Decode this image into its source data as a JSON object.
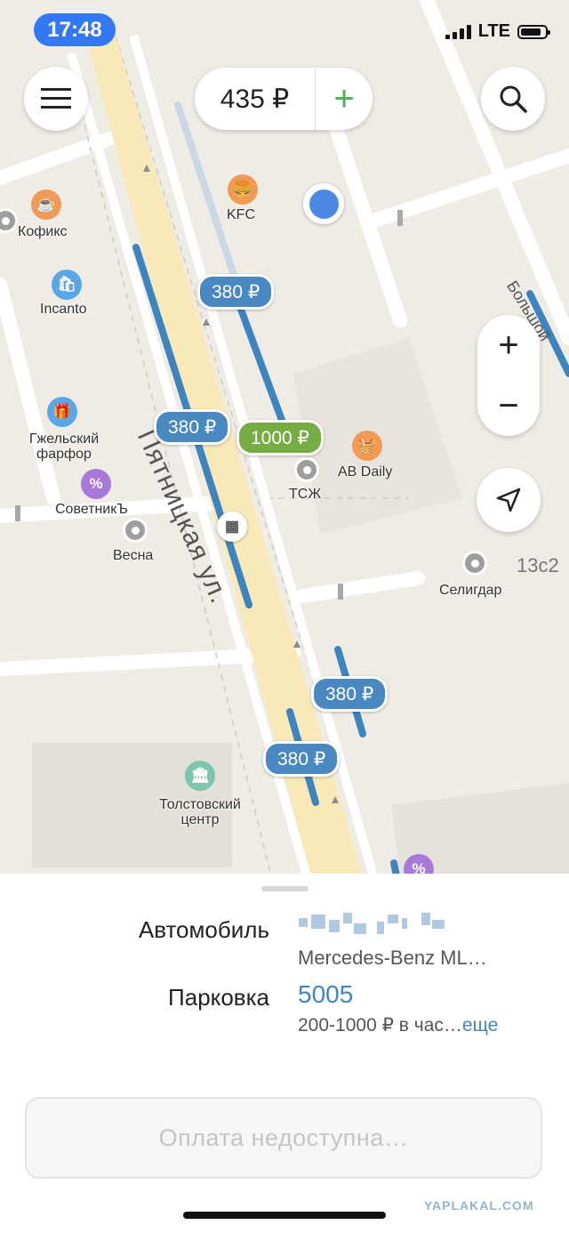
{
  "status_bar": {
    "time": "17:48",
    "network": "LTE"
  },
  "balance": {
    "amount": "435 ₽",
    "add_label": "+"
  },
  "zoom": {
    "in_label": "+",
    "out_label": "−"
  },
  "map": {
    "street_name": "Пятницкая ул.",
    "street_name_2": "Большой",
    "house_number": "13с2",
    "poi": {
      "kfc": "KFC",
      "kofiks": "Кофикс",
      "incanto": "Incanto",
      "gzhel": "Гжельский фарфор",
      "sovetnik": "СоветникЪ",
      "vesna": "Весна",
      "tszh": "ТСЖ",
      "av_daily": "AB Daily",
      "seligdar": "Селигдар",
      "tolstoy": "Толстовский центр"
    },
    "prices": [
      "380 ₽",
      "380 ₽",
      "1000 ₽",
      "380 ₽",
      "380 ₽"
    ]
  },
  "sheet": {
    "car_label": "Автомобиль",
    "car_model": "Mercedes-Benz ML…",
    "parking_label": "Парковка",
    "parking_code": "5005",
    "parking_rate": "200-1000 ₽ в час…",
    "more_link": "еще",
    "pay_button": "Оплата недоступна…"
  },
  "watermark": "YAPLAKAL.COM",
  "colors": {
    "accent_blue": "#3f86c8",
    "zone_blue": "#4a88c2",
    "zone_green": "#75ac44",
    "status_blue": "#3478f6"
  }
}
